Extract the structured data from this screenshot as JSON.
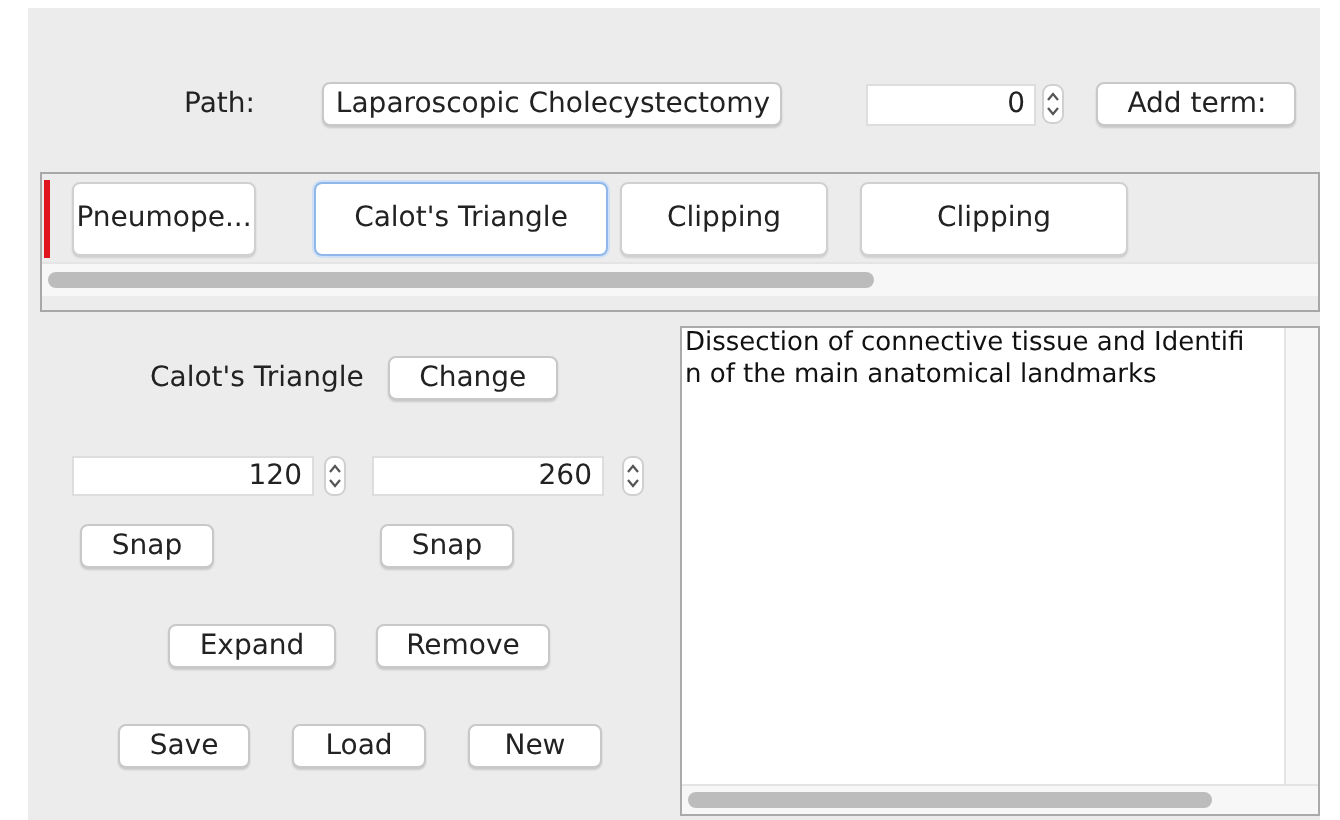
{
  "path": {
    "label": "Path:",
    "value": "Laparoscopic Cholecystectomy"
  },
  "term_index": {
    "value": "0"
  },
  "add_term_button": "Add term:",
  "steps": [
    {
      "label": "Pneumope...",
      "selected": false
    },
    {
      "label": "Calot's Triangle",
      "selected": true
    },
    {
      "label": "Clipping",
      "selected": false
    },
    {
      "label": "Clipping",
      "selected": false
    }
  ],
  "step_editor": {
    "title": "Calot's Triangle",
    "change_button": "Change",
    "start": "120",
    "end": "260",
    "snap_buttons": [
      "Snap",
      "Snap"
    ],
    "action_buttons": [
      "Expand",
      "Remove"
    ],
    "file_buttons": [
      "Save",
      "Load",
      "New"
    ]
  },
  "description": [
    "Dissection of connective tissue and Identifi",
    "n of the main anatomical landmarks"
  ]
}
